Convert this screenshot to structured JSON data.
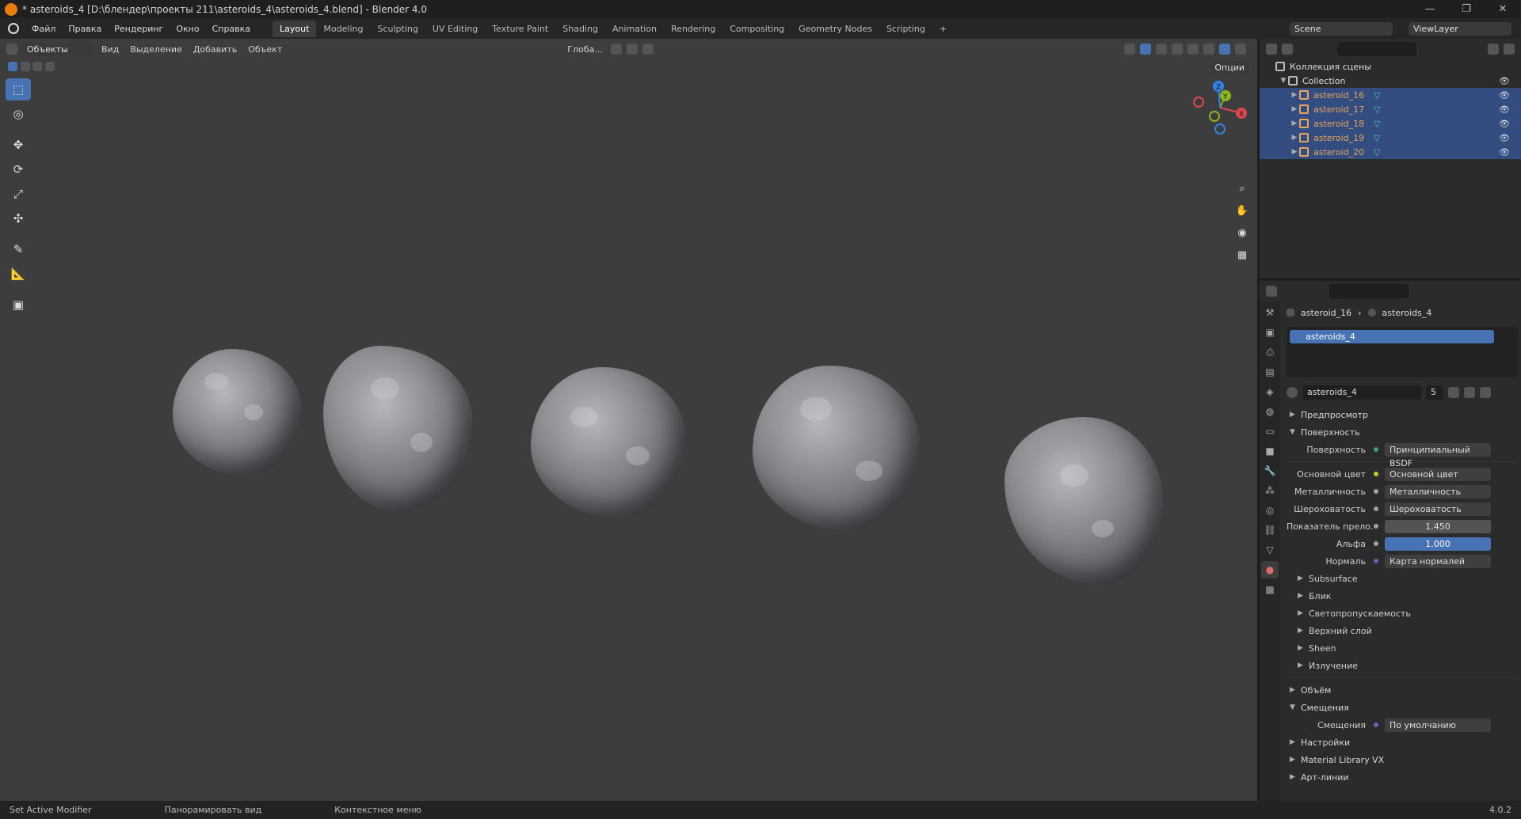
{
  "window": {
    "title": "* asteroids_4 [D:\\блендер\\проекты 211\\asteroids_4\\asteroids_4.blend] - Blender 4.0"
  },
  "menu": [
    "Файл",
    "Правка",
    "Рендеринг",
    "Окно",
    "Справка"
  ],
  "workspaces": [
    "Layout",
    "Modeling",
    "Sculpting",
    "UV Editing",
    "Texture Paint",
    "Shading",
    "Animation",
    "Rendering",
    "Compositing",
    "Geometry Nodes",
    "Scripting"
  ],
  "active_workspace": "Layout",
  "scene": {
    "label": "Scene",
    "view_layer": "ViewLayer"
  },
  "viewport_header": {
    "mode": "Объекты",
    "menus": [
      "Вид",
      "Выделение",
      "Добавить",
      "Объект"
    ],
    "transform": "Глоба...",
    "options": "Опции"
  },
  "toolbar": {
    "tools": [
      "select-box",
      "cursor",
      "move",
      "rotate",
      "scale",
      "transform",
      "annotate",
      "measure",
      "add-cube"
    ]
  },
  "gizmo": {
    "axes": [
      "X",
      "Y",
      "Z"
    ]
  },
  "outliner": {
    "root": "Коллекция сцены",
    "collection": "Collection",
    "objects": [
      "asteroid_16",
      "asteroid_17",
      "asteroid_18",
      "asteroid_19",
      "asteroid_20"
    ]
  },
  "properties": {
    "object": "asteroid_16",
    "material": "asteroids_4",
    "slot": "asteroids_4",
    "users": "5",
    "sections": {
      "preview": "Предпросмотр",
      "surface": "Поверхность",
      "volume": "Объём",
      "displacement": "Смещения",
      "settings": "Настройки",
      "matlib": "Material Library VX",
      "lineart": "Арт-линии"
    },
    "surface": {
      "label": "Поверхность",
      "value": "Принципиальный BSDF"
    },
    "inputs": [
      {
        "label": "Основной цвет",
        "value": "Основной цвет",
        "dot": "#c7c729",
        "expand": true
      },
      {
        "label": "Металличность",
        "value": "Металличность",
        "dot": "#a1a1a1",
        "expand": true
      },
      {
        "label": "Шероховатость",
        "value": "Шероховатость",
        "dot": "#a1a1a1",
        "expand": true
      },
      {
        "label": "Показатель прело...",
        "value": "1.450",
        "dot": "#a1a1a1",
        "kind": "num"
      },
      {
        "label": "Альфа",
        "value": "1.000",
        "dot": "#a1a1a1",
        "kind": "blue"
      },
      {
        "label": "Нормаль",
        "value": "Карта нормалей",
        "dot": "#6363c7",
        "expand": true
      }
    ],
    "subpanels": [
      "Subsurface",
      "Блик",
      "Светопропускаемость",
      "Верхний слой",
      "Sheen",
      "Излучение"
    ],
    "displacement": {
      "label": "Смещения",
      "value": "По умолчанию"
    }
  },
  "status": {
    "left": "Set Active Modifier",
    "middle": "Панорамировать вид",
    "right": "Контекстное меню",
    "version": "4.0.2"
  }
}
